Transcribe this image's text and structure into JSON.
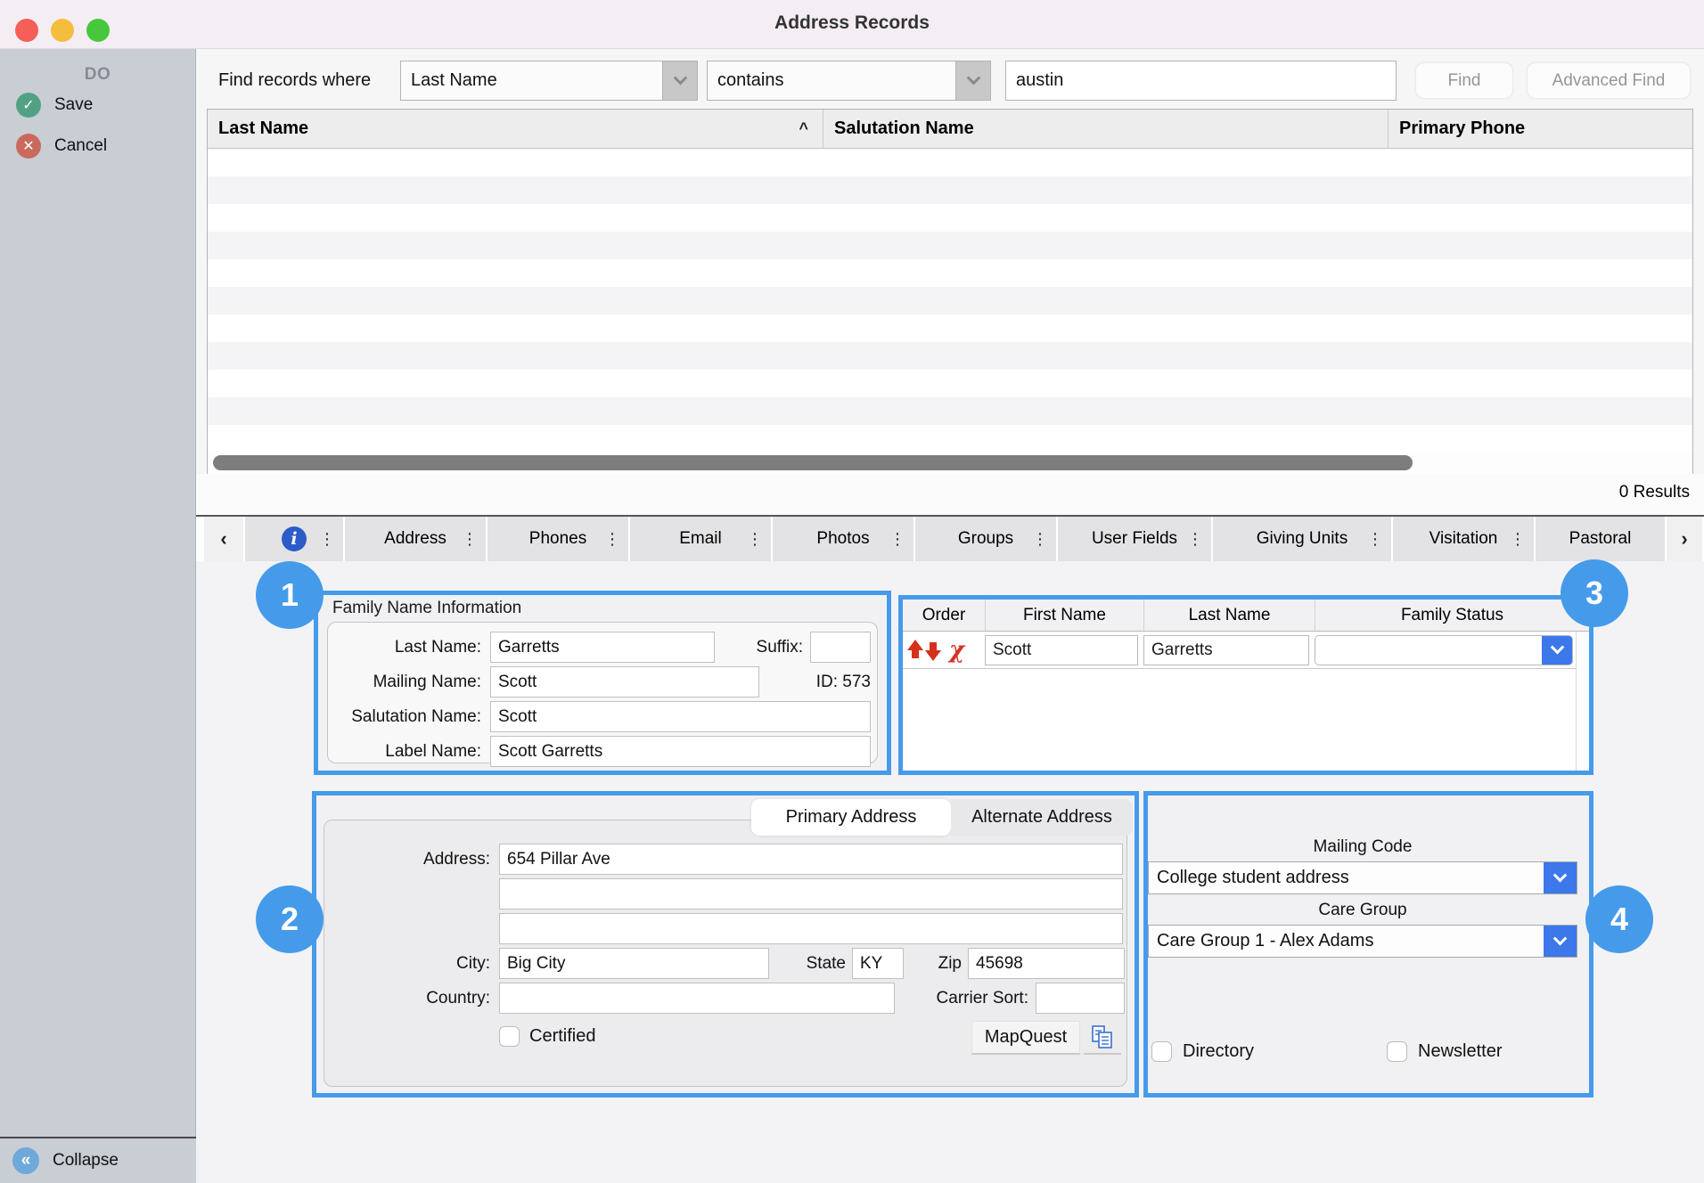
{
  "window": {
    "title": "Address Records"
  },
  "sidebar": {
    "header": "DO",
    "save_label": "Save",
    "cancel_label": "Cancel",
    "collapse_label": "Collapse",
    "save_glyph": "✓",
    "cancel_glyph": "✕",
    "collapse_glyph": "«"
  },
  "search": {
    "label": "Find records where",
    "field_select_value": "Last Name",
    "operator_select_value": "contains",
    "query_value": "austin",
    "find_label": "Find",
    "advanced_find_label": "Advanced Find"
  },
  "results_table": {
    "columns": [
      "Last Name",
      "Salutation Name",
      "Primary Phone"
    ],
    "sort_indicator": "^",
    "results_count": "0 Results"
  },
  "tabs": {
    "nav_left": "‹",
    "nav_right": "›",
    "info_glyph": "i",
    "dots": "⋮",
    "items": [
      "Address",
      "Phones",
      "Email",
      "Photos",
      "Groups",
      "User Fields",
      "Giving Units",
      "Visitation",
      "Pastoral"
    ]
  },
  "family_name_info": {
    "section_number": "1",
    "legend": "Family Name Information",
    "last_name_label": "Last Name:",
    "last_name_value": "Garretts",
    "suffix_label": "Suffix:",
    "suffix_value": "",
    "mailing_name_label": "Mailing Name:",
    "mailing_name_value": "Scott",
    "id_text": "ID: 573",
    "salutation_label": "Salutation Name:",
    "salutation_value": "Scott",
    "label_name_label": "Label Name:",
    "label_name_value": "Scott Garretts"
  },
  "members_table": {
    "section_number": "3",
    "columns": [
      "Order",
      "First Name",
      "Last Name",
      "Family Status"
    ],
    "rows": [
      {
        "first_name": "Scott",
        "last_name": "Garretts",
        "family_status": ""
      }
    ]
  },
  "address_section": {
    "section_number": "2",
    "primary_tab": "Primary Address",
    "alternate_tab": "Alternate Address",
    "address_label": "Address:",
    "address_line1": "654 Pillar Ave",
    "address_line2": "",
    "address_line3": "",
    "city_label": "City:",
    "city_value": "Big City",
    "state_label": "State",
    "state_value": "KY",
    "zip_label": "Zip",
    "zip_value": "45698",
    "country_label": "Country:",
    "country_value": "",
    "carrier_sort_label": "Carrier Sort:",
    "carrier_sort_value": "",
    "certified_label": "Certified",
    "mapquest_label": "MapQuest"
  },
  "mailing_section": {
    "section_number": "4",
    "mailing_code_label": "Mailing Code",
    "mailing_code_value": "College student address",
    "care_group_label": "Care Group",
    "care_group_value": "Care Group 1 - Alex Adams",
    "directory_label": "Directory",
    "newsletter_label": "Newsletter"
  },
  "colors": {
    "accent_blue": "#459bea",
    "dropdown_blue": "#3c78e9",
    "info_blue": "#2b5cc7",
    "save_green": "#52a184",
    "cancel_red": "#ca6a5e",
    "delete_red": "#d6301d"
  }
}
